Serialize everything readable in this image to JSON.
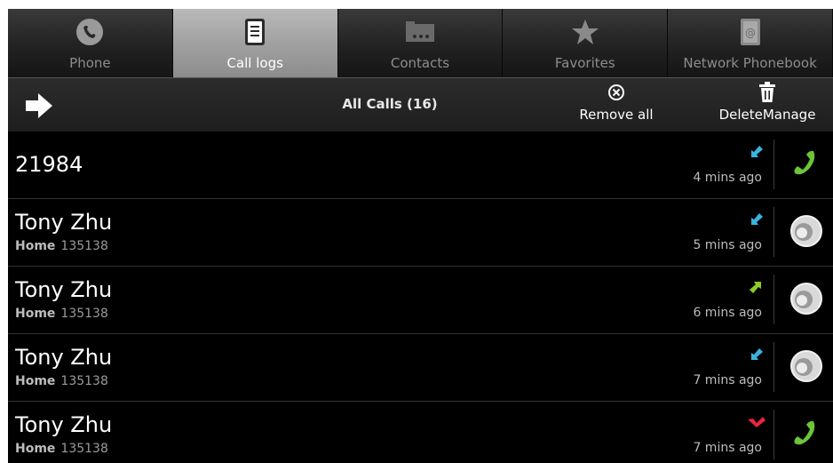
{
  "tabs": [
    {
      "label": "Phone",
      "icon": "phone-icon",
      "active": false
    },
    {
      "label": "Call logs",
      "icon": "call-log-icon",
      "active": true
    },
    {
      "label": "Contacts",
      "icon": "contacts-icon",
      "active": false
    },
    {
      "label": "Favorites",
      "icon": "star-icon",
      "active": false
    },
    {
      "label": "Network Phonebook",
      "icon": "network-phonebook-icon",
      "active": false
    }
  ],
  "actionbar": {
    "title": "All Calls (16)",
    "remove_all_label": "Remove all",
    "delete_manage_label": "DeleteManage"
  },
  "calls": [
    {
      "name": "21984",
      "type_label": "",
      "number": "",
      "time": "4 mins ago",
      "direction": "incoming",
      "action": "call-icon"
    },
    {
      "name": "Tony Zhu",
      "type_label": "Home",
      "number": "135138",
      "time": "5 mins ago",
      "direction": "incoming",
      "action": "contact-photo-icon"
    },
    {
      "name": "Tony Zhu",
      "type_label": "Home",
      "number": "135138",
      "time": "6 mins ago",
      "direction": "outgoing",
      "action": "contact-photo-icon"
    },
    {
      "name": "Tony Zhu",
      "type_label": "Home",
      "number": "135138",
      "time": "7 mins ago",
      "direction": "incoming",
      "action": "contact-photo-icon"
    },
    {
      "name": "Tony Zhu",
      "type_label": "Home",
      "number": "135138",
      "time": "7 mins ago",
      "direction": "missed",
      "action": "call-icon"
    }
  ],
  "colors": {
    "incoming": "#3bb3e0",
    "outgoing": "#8ecb2a",
    "missed": "#e8253c",
    "call_green": "#6cc43a"
  }
}
